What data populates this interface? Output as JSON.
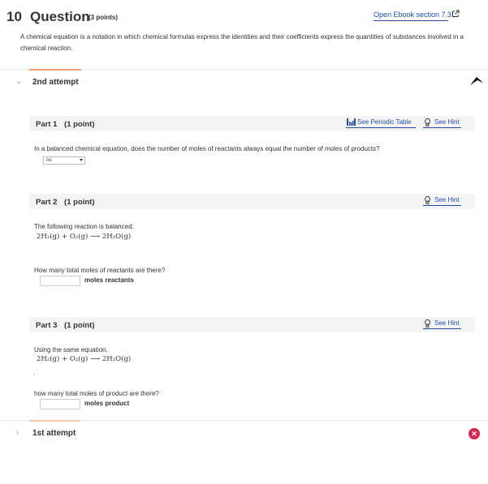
{
  "question": {
    "number": "10",
    "title": "Question",
    "points": "(3 points)",
    "ebook_link": "Open Ebook section 7.3",
    "description": "A chemical equation is a notation in which chemical formulas express the identities and their coefficients express the quantities of substances involved in a chemical reaction."
  },
  "attempts": {
    "current_label": "2nd attempt",
    "previous_label": "1st attempt",
    "previous_status_icon": "x-circle-icon"
  },
  "parts": [
    {
      "title": "Part 1",
      "points": "(1 point)",
      "periodic_table_link": "See Periodic Table",
      "hint_link": "See Hint",
      "prompt": "In a balanced chemical equation, does the number of moles of reactants always equal the number of moles of products?",
      "selected_value": "no"
    },
    {
      "title": "Part 2",
      "points": "(1 point)",
      "hint_link": "See Hint",
      "intro": "The following reaction is balanced:",
      "equation": "2H₂(g) + O₂(g) ⟶ 2H₂O(g)",
      "question": "How many total moles of reactants are there?",
      "input_value": "",
      "unit_label": "moles reactants"
    },
    {
      "title": "Part 3",
      "points": "(1 point)",
      "hint_link": "See Hint",
      "intro": "Using the same equation,",
      "equation": "2H₂(g) + O₂(g) ⟶ 2H₂O(g)",
      "trailing_mark": ".",
      "question": "how many total moles of product are there?",
      "input_value": "",
      "unit_label": "moles product"
    }
  ],
  "colors": {
    "link": "#1f4fa3",
    "accent": "#f5a070",
    "error": "#d9254c",
    "part_header_bg": "#f4f4f4"
  }
}
